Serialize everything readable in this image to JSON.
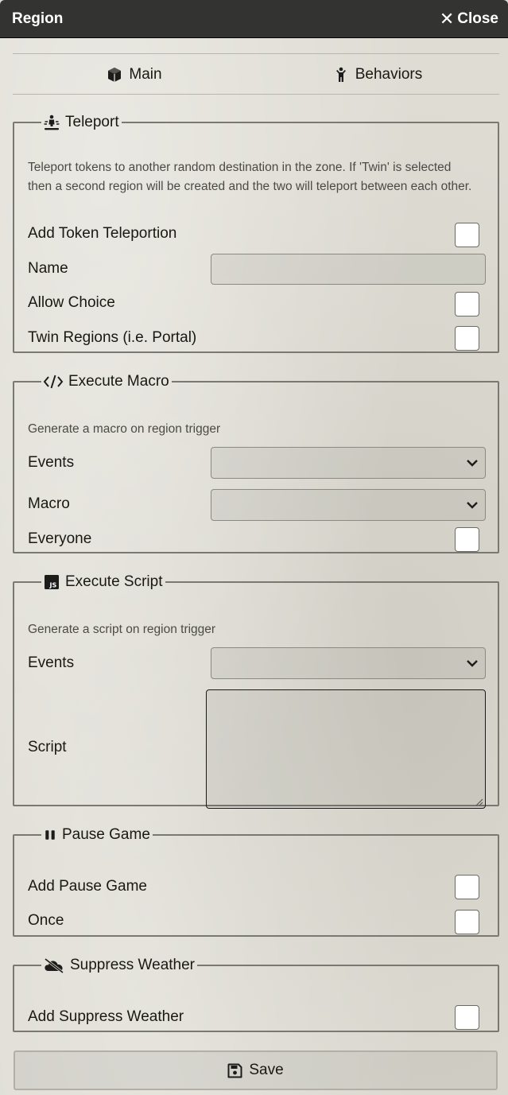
{
  "window": {
    "title": "Region",
    "close_label": "Close"
  },
  "tabs": [
    {
      "label": "Main",
      "icon": "cube-icon"
    },
    {
      "label": "Behaviors",
      "icon": "child-icon"
    }
  ],
  "teleport": {
    "legend": "Teleport",
    "icon": "teleport-person-icon",
    "description": "Teleport tokens to another random destination in the zone. If 'Twin' is selected then a second region will be created and the two will teleport between each other.",
    "add_label": "Add Token Teleportion",
    "name_label": "Name",
    "name_value": "",
    "allow_choice_label": "Allow Choice",
    "twin_label": "Twin Regions (i.e. Portal)"
  },
  "execute_macro": {
    "legend": "Execute Macro",
    "icon": "code-icon",
    "description": "Generate a macro on region trigger",
    "events_label": "Events",
    "events_value": "",
    "macro_label": "Macro",
    "macro_value": "",
    "everyone_label": "Everyone"
  },
  "execute_script": {
    "legend": "Execute Script",
    "icon": "js-icon",
    "description": "Generate a script on region trigger",
    "events_label": "Events",
    "events_value": "",
    "script_label": "Script",
    "script_value": ""
  },
  "pause_game": {
    "legend": "Pause Game",
    "icon": "pause-icon",
    "add_label": "Add Pause Game",
    "once_label": "Once"
  },
  "suppress_weather": {
    "legend": "Suppress Weather",
    "icon": "cloud-slash-icon",
    "add_label": "Add Suppress Weather"
  },
  "footer": {
    "save_label": "Save",
    "icon": "floppy-disk-icon"
  }
}
